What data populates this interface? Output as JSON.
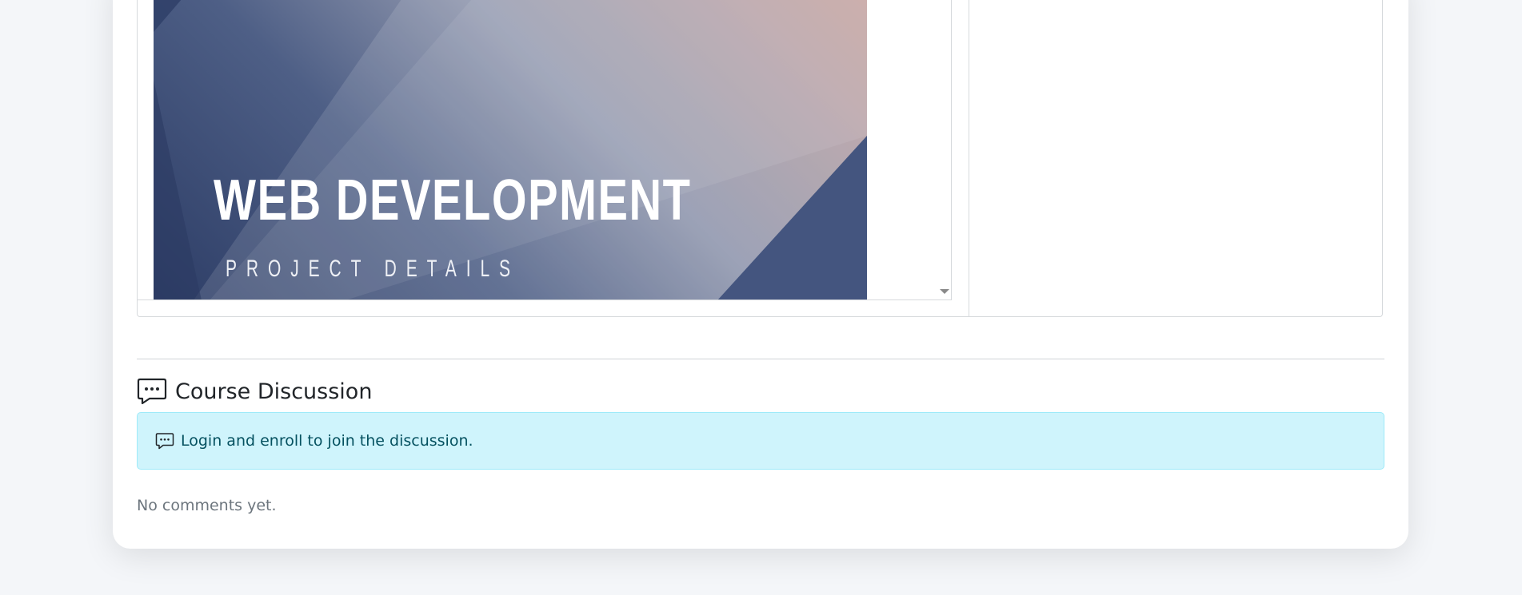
{
  "viewer": {
    "slide_title": "WEB DEVELOPMENT",
    "slide_subtitle": "PROJECT DETAILS"
  },
  "discussion": {
    "title": "Course Discussion",
    "icon": "chat-dots-icon",
    "alert_text": "Login and enroll to join the discussion.",
    "alert_icon": "chat-dots-icon",
    "empty_text": "No comments yet."
  },
  "colors": {
    "alert_bg": "#cff4fc",
    "alert_text": "#055160",
    "muted_text": "#6c757d"
  }
}
